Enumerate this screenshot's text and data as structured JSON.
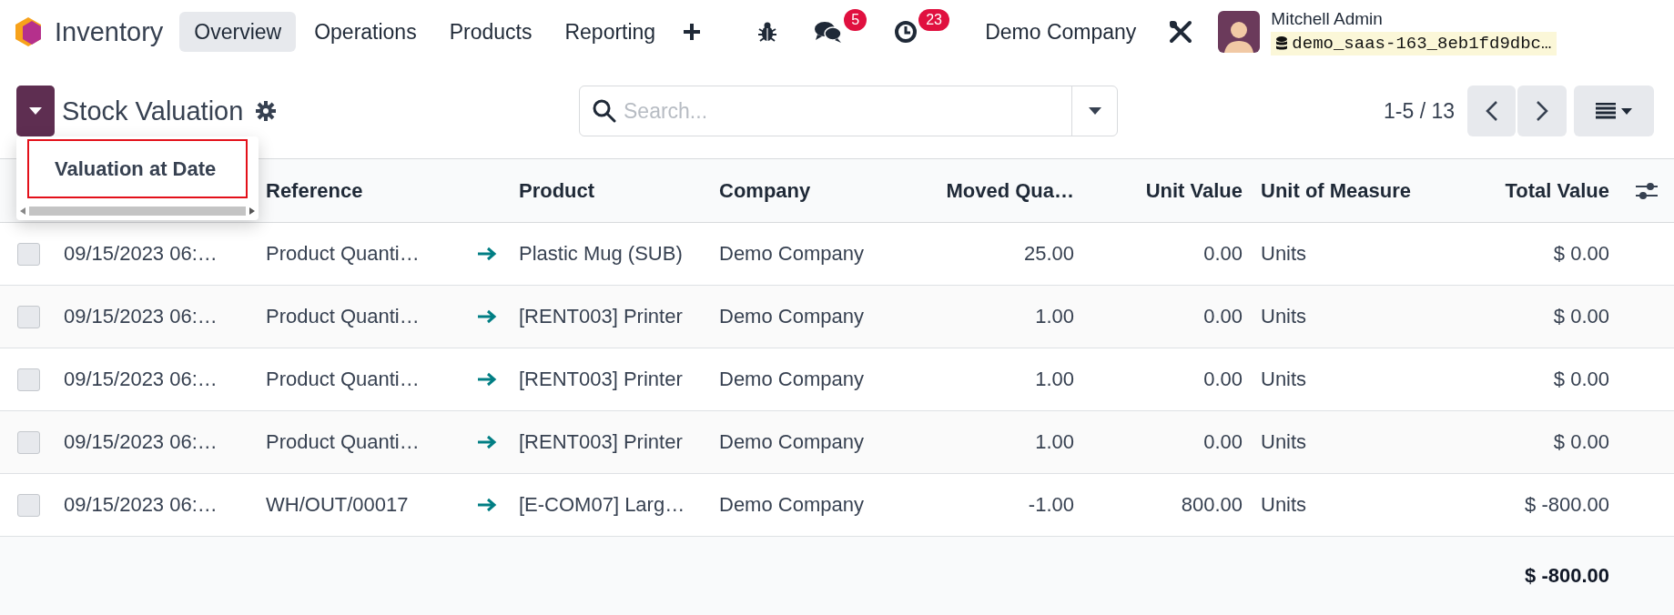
{
  "navbar": {
    "app_name": "Inventory",
    "menus": [
      {
        "label": "Overview",
        "selected": true
      },
      {
        "label": "Operations",
        "selected": false
      },
      {
        "label": "Products",
        "selected": false
      },
      {
        "label": "Reporting",
        "selected": false
      }
    ],
    "chat_count": "5",
    "activity_count": "23",
    "company": "Demo Company",
    "user": {
      "name": "Mitchell Admin",
      "database": "demo_saas-163_8eb1fd9dbc…"
    }
  },
  "control_panel": {
    "title": "Stock Valuation",
    "search": {
      "placeholder": "Search..."
    },
    "pager": "1-5 / 13"
  },
  "dropdown": {
    "items": [
      {
        "label": "Valuation at Date",
        "highlighted": true
      }
    ]
  },
  "table": {
    "columns": [
      {
        "label": "Reference",
        "kind": "text"
      },
      {
        "label": "Product",
        "kind": "text"
      },
      {
        "label": "Company",
        "kind": "text"
      },
      {
        "label": "Moved Qua…",
        "kind": "number"
      },
      {
        "label": "Unit Value",
        "kind": "number"
      },
      {
        "label": "Unit of Measure",
        "kind": "text"
      },
      {
        "label": "Total Value",
        "kind": "number"
      }
    ],
    "rows": [
      {
        "checked": false,
        "date": "09/15/2023 06:…",
        "reference": "Product Quanti…",
        "product": "Plastic Mug (SUB)",
        "company": "Demo Company",
        "moved_quantity": "25.00",
        "unit_value": "0.00",
        "unit_of_measure": "Units",
        "total_value": "$ 0.00"
      },
      {
        "checked": false,
        "date": "09/15/2023 06:…",
        "reference": "Product Quanti…",
        "product": "[RENT003] Printer",
        "company": "Demo Company",
        "moved_quantity": "1.00",
        "unit_value": "0.00",
        "unit_of_measure": "Units",
        "total_value": "$ 0.00"
      },
      {
        "checked": false,
        "date": "09/15/2023 06:…",
        "reference": "Product Quanti…",
        "product": "[RENT003] Printer",
        "company": "Demo Company",
        "moved_quantity": "1.00",
        "unit_value": "0.00",
        "unit_of_measure": "Units",
        "total_value": "$ 0.00"
      },
      {
        "checked": false,
        "date": "09/15/2023 06:…",
        "reference": "Product Quanti…",
        "product": "[RENT003] Printer",
        "company": "Demo Company",
        "moved_quantity": "1.00",
        "unit_value": "0.00",
        "unit_of_measure": "Units",
        "total_value": "$ 0.00"
      },
      {
        "checked": false,
        "date": "09/15/2023 06:…",
        "reference": "WH/OUT/00017",
        "product": "[E-COM07] Larg…",
        "company": "Demo Company",
        "moved_quantity": "-1.00",
        "unit_value": "800.00",
        "unit_of_measure": "Units",
        "total_value": "$ -800.00"
      }
    ],
    "total": "$ -800.00"
  }
}
